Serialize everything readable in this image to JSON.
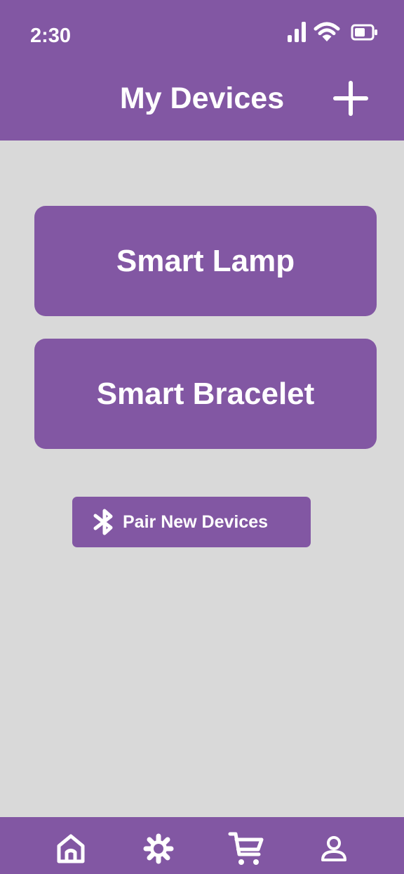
{
  "status_bar": {
    "time": "2:30",
    "icons": [
      "signal-icon",
      "wifi-icon",
      "battery-icon"
    ]
  },
  "header": {
    "title": "My Devices",
    "action_icon": "plus-icon"
  },
  "devices": [
    {
      "label": "Smart Lamp"
    },
    {
      "label": "Smart Bracelet"
    }
  ],
  "pair_button": {
    "icon": "bluetooth-icon",
    "label": "Pair New Devices"
  },
  "bottom_nav": {
    "items": [
      "home-icon",
      "settings-icon",
      "cart-icon",
      "profile-icon"
    ]
  },
  "colors": {
    "primary": "#8257A3",
    "background": "#D9D9D9",
    "foreground": "#FFFFFF"
  }
}
